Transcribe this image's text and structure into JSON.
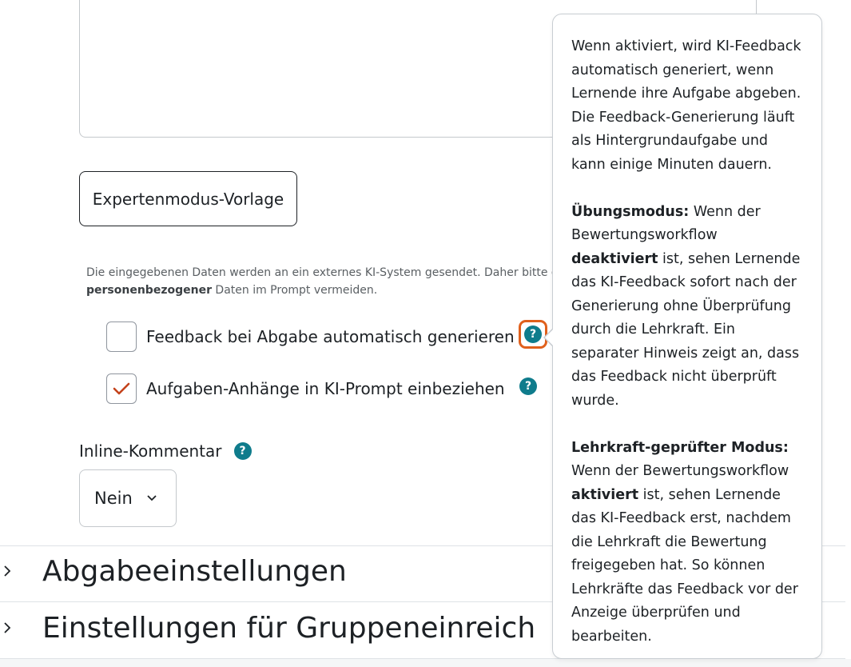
{
  "expert_template_button": "Expertenmodus-Vorlage",
  "notice": {
    "line1": "Die eingegebenen Daten werden an ein externes KI-System gesendet. Daher bitte di",
    "bold": "personenbezogener",
    "line2": " Daten im Prompt vermeiden."
  },
  "options": [
    {
      "label": "Feedback bei Abgabe automatisch generieren",
      "checked": false
    },
    {
      "label": "Aufgaben-Anhänge in KI-Prompt einbeziehen",
      "checked": true
    }
  ],
  "help_icon_glyph": "?",
  "inline_comment": {
    "label": "Inline-Kommentar",
    "selected": "Nein"
  },
  "sections": [
    {
      "title": "Abgabeeinstellungen"
    },
    {
      "title": "Einstellungen für Gruppeneinreich"
    }
  ],
  "popover": {
    "intro": "Wenn aktiviert, wird KI-Feedback automatisch generiert, wenn Lernende ihre Aufgabe abgeben. Die Feedback-Generierung läuft als Hintergrundaufgabe und kann einige Minuten dauern.",
    "practice_heading": "Übungsmodus:",
    "practice_text_1": " Wenn der Bewertungsworkflow ",
    "practice_bold": "deaktiviert",
    "practice_text_2": " ist, sehen Lernende das KI-Feedback sofort nach der Generierung ohne Überprüfung durch die Lehrkraft. Ein separater Hinweis zeigt an, dass das Feedback nicht überprüft wurde.",
    "teacher_heading": "Lehrkraft-geprüfter Modus:",
    "teacher_text_1": " Wenn der Bewertungsworkflow ",
    "teacher_bold": "aktiviert",
    "teacher_text_2": " ist, sehen Lernende das KI-Feedback erst, nachdem die Lehrkraft die Bewertung freigegeben hat. So können Lehrkräfte das Feedback vor der Anzeige überprüfen und bearbeiten."
  },
  "colors": {
    "accent_teal": "#0f7c8c",
    "focus_orange": "#e0601c",
    "check_red": "#c4421b"
  }
}
